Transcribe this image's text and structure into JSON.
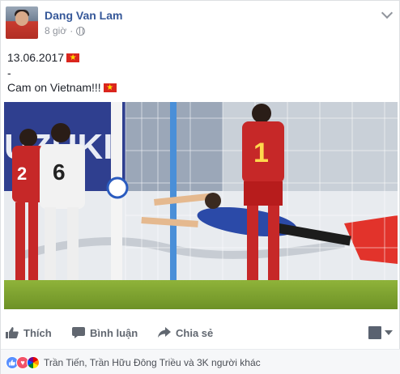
{
  "post": {
    "author": "Dang Van Lam",
    "time": "8 giờ",
    "line1": "13.06.2017",
    "line2": "-",
    "line3": "Cam on Vietnam!!!",
    "photo_text": {
      "banner": "UZUKI",
      "jersey_front": "1",
      "jersey_left": "2",
      "jersey_white": "6"
    }
  },
  "actions": {
    "like": "Thích",
    "comment": "Bình luận",
    "share": "Chia sẻ"
  },
  "reactions": {
    "text": "Trần Tiến, Trần Hữu Đông Triều và 3K người khác",
    "types": [
      "like-icon",
      "love-icon",
      "pride-icon"
    ]
  },
  "colors": {
    "author_link": "#365899",
    "flag_red": "#da251d",
    "flag_star": "#ffdd00"
  }
}
